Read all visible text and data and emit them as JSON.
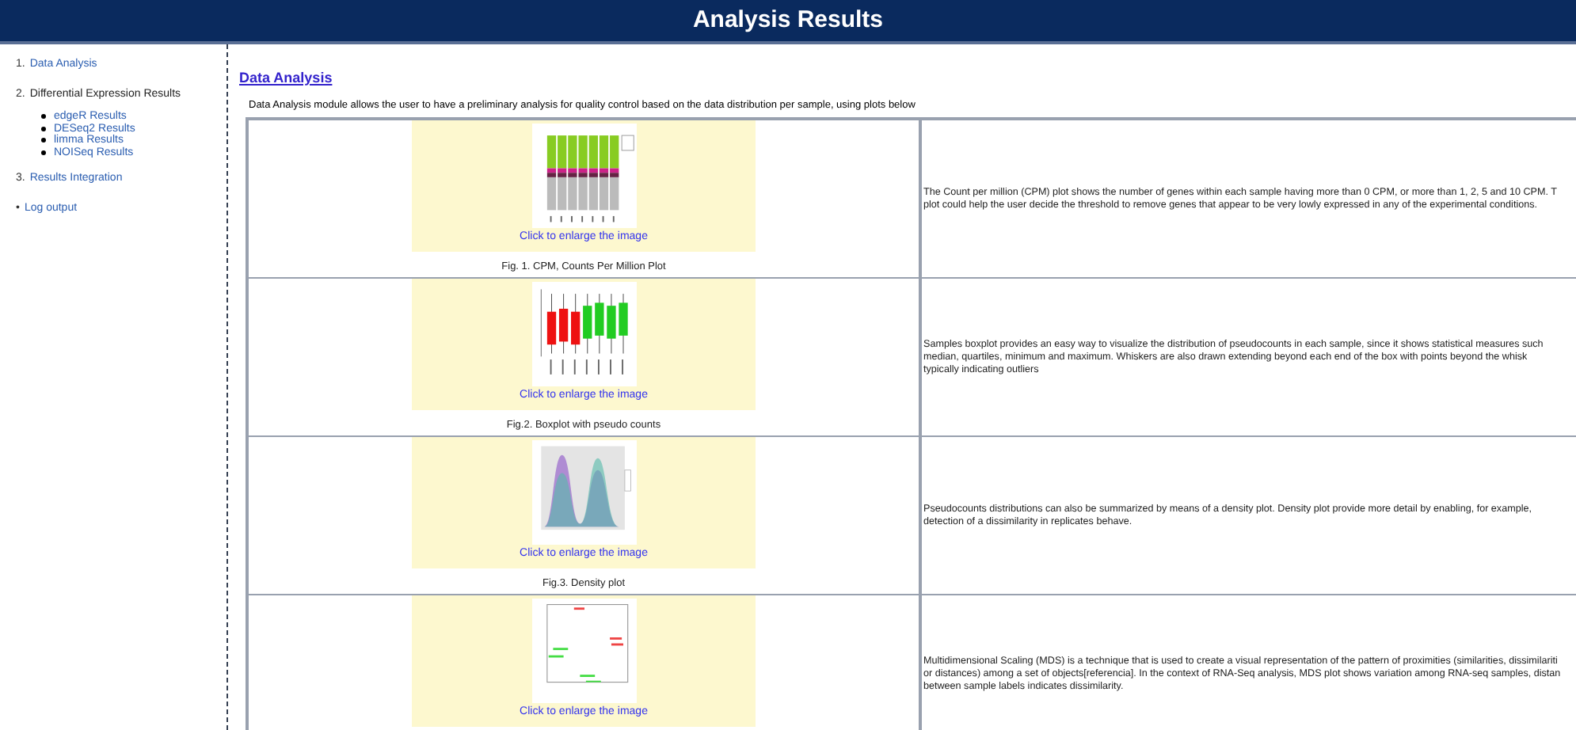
{
  "header": {
    "title": "Analysis Results"
  },
  "sidebar": {
    "items": [
      {
        "number": "1.",
        "label": "Data Analysis",
        "link": true
      },
      {
        "number": "2.",
        "label": "Differential Expression Results",
        "link": false,
        "children": [
          {
            "label": "edgeR Results"
          },
          {
            "label": "DESeq2 Results"
          },
          {
            "label": "limma Results"
          },
          {
            "label": "NOISeq Results"
          }
        ]
      },
      {
        "number": "3.",
        "label": "Results Integration",
        "link": true
      },
      {
        "number": "•",
        "label": "Log output",
        "link": true
      }
    ]
  },
  "section": {
    "heading": "Data Analysis",
    "intro": "Data Analysis module allows the user to have a preliminary analysis for quality control based on the data distribution per sample, using plots below"
  },
  "rows": [
    {
      "kind": "stacked-bar",
      "link": "Click to enlarge the image",
      "caption": "Fig. 1. CPM, Counts Per Million Plot",
      "description": [
        "The Count per million (CPM) plot shows the number of genes within each sample having more than 0 CPM, or more than 1, 2, 5 and 10 CPM. T",
        "plot could help the user decide the threshold to remove genes that appear to be very lowly expressed in any of the experimental conditions."
      ]
    },
    {
      "kind": "boxplot",
      "link": "Click to enlarge the image",
      "caption": "Fig.2. Boxplot with pseudo counts",
      "description": [
        "Samples boxplot provides an easy way to visualize the distribution of pseudocounts in each sample, since it shows statistical measures such",
        "median, quartiles, minimum and maximum. Whiskers are also drawn extending beyond each end of the box with points beyond the whisk",
        "typically indicating outliers"
      ]
    },
    {
      "kind": "density",
      "link": "Click to enlarge the image",
      "caption": "Fig.3. Density plot",
      "description": [
        "Pseudocounts distributions can also be summarized by means of a density plot. Density plot provide more detail by enabling, for example,",
        "detection of a dissimilarity in replicates behave."
      ]
    },
    {
      "kind": "mds",
      "link": "Click to enlarge the image",
      "description": [
        "Multidimensional Scaling (MDS) is a technique that is used to create a visual representation of the pattern of proximities (similarities, dissimilariti",
        "or distances) among a set of objects[referencia]. In the context of RNA-Seq analysis, MDS plot shows variation among RNA-seq samples, distan",
        "between sample labels indicates dissimilarity."
      ]
    }
  ]
}
